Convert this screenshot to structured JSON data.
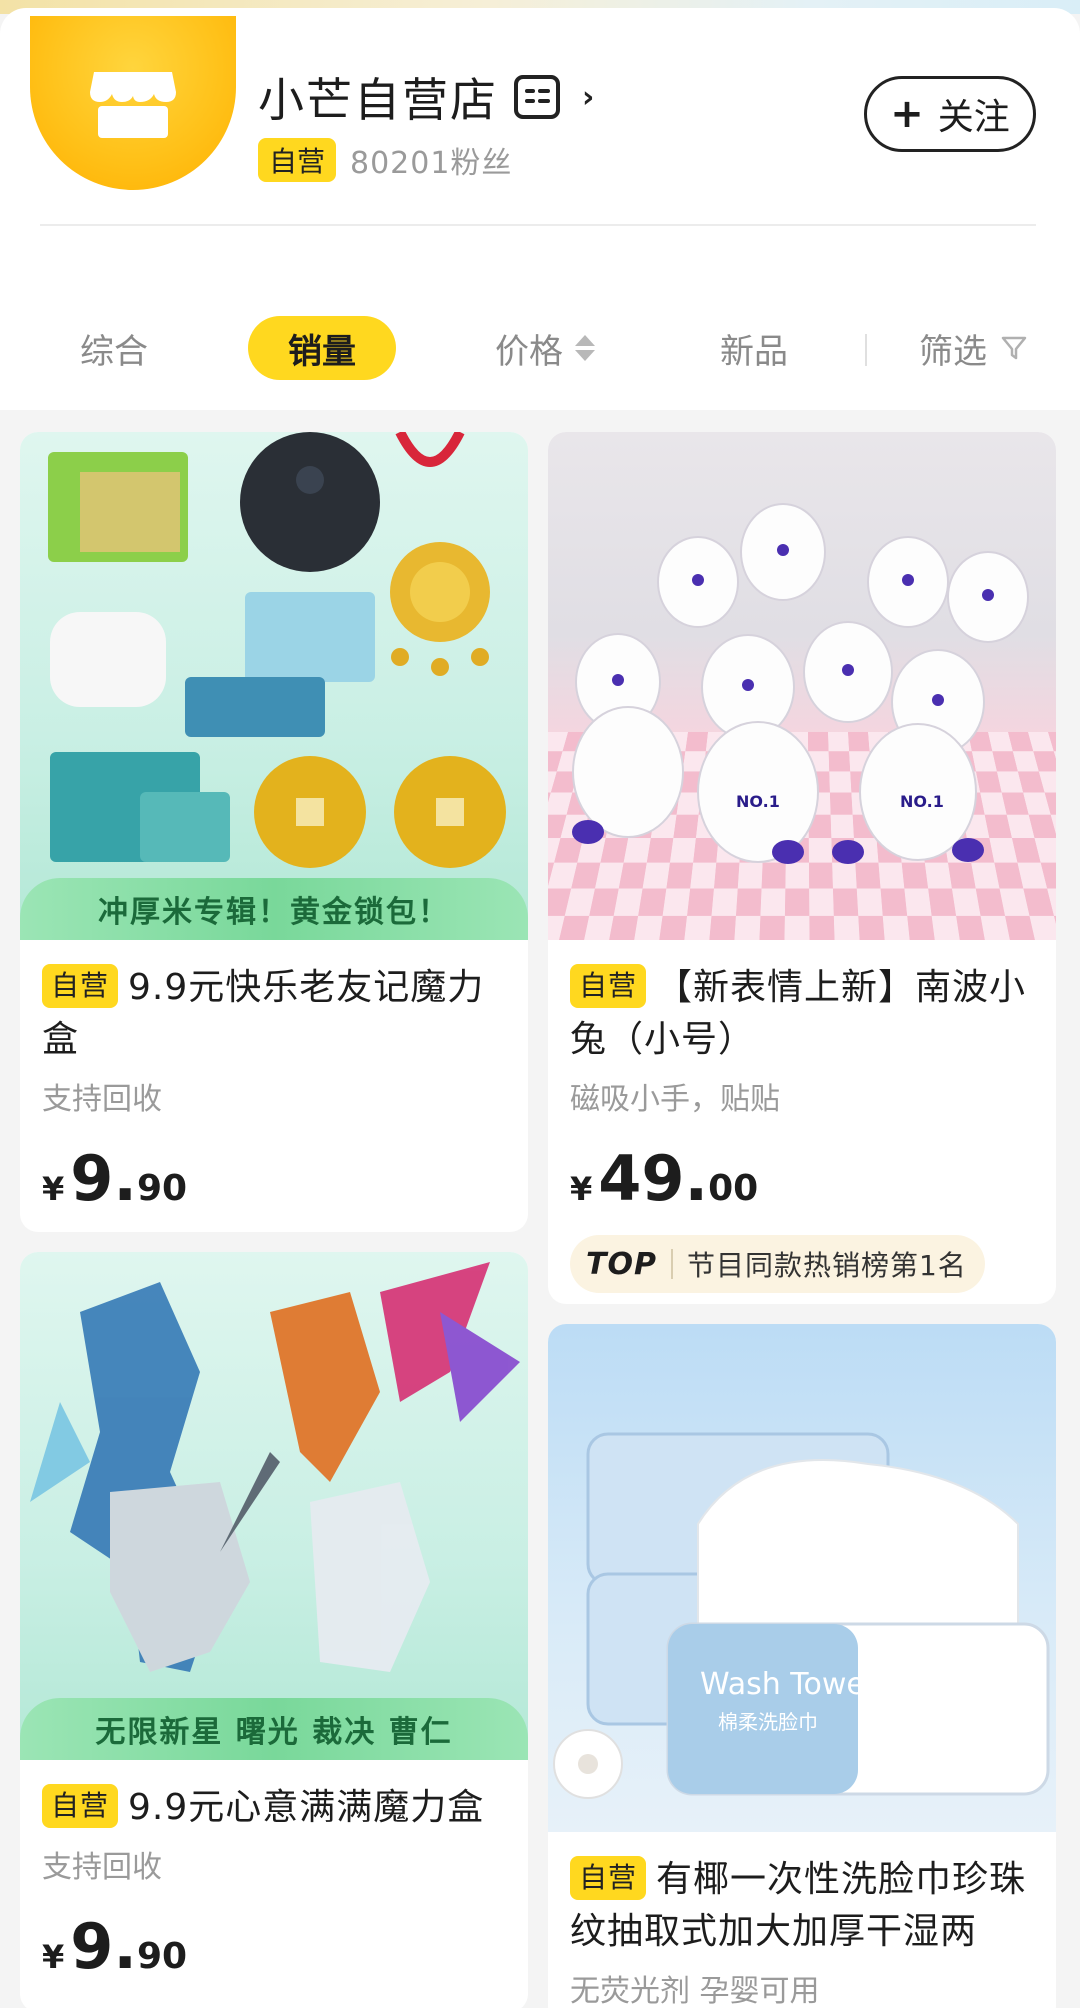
{
  "store": {
    "name": "小芒自营店",
    "self_label": "自营",
    "fans": "80201粉丝",
    "follow_label": "关注",
    "follow_plus": "+"
  },
  "sort_tabs": {
    "overall": "综合",
    "sales": "销量",
    "price": "价格",
    "new": "新品",
    "filter": "筛选",
    "active": "sales"
  },
  "colors": {
    "accent_yellow": "#ffd81f",
    "price_black": "#1d1d1d",
    "muted_gray": "#9a9a9a"
  },
  "products": [
    {
      "badge": "自营",
      "title": "9.9元快乐老友记魔力盒",
      "subtitle": "支持回收",
      "price_symbol": "¥",
      "price_int": "9.",
      "price_dec": "90",
      "image_banner": "冲厚米专辑！黄金锁包！"
    },
    {
      "badge": "自营",
      "title": "【新表情上新】南波小兔（小号）",
      "subtitle": "磁吸小手，贴贴",
      "price_symbol": "¥",
      "price_int": "49.",
      "price_dec": "00",
      "rank_logo": "TOP",
      "rank_text": "节目同款热销榜第1名",
      "image_label": "NO.1"
    },
    {
      "badge": "自营",
      "title": "9.9元心意满满魔力盒",
      "subtitle": "支持回收",
      "price_symbol": "¥",
      "price_int": "9.",
      "price_dec": "90",
      "image_banner": "无限新星 曙光 裁决 曹仁"
    },
    {
      "badge": "自营",
      "title": "有椰一次性洗脸巾珍珠纹抽取式加大加厚干湿两",
      "subtitle": "无荧光剂 孕婴可用",
      "image_label": "Wash Towel",
      "image_sublabel": "棉柔洗脸巾"
    }
  ]
}
